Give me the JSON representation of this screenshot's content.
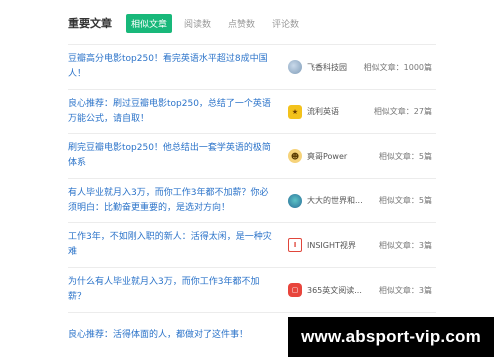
{
  "header": {
    "title": "重要文章",
    "tabs": [
      {
        "label": "相似文章",
        "active": true
      },
      {
        "label": "阅读数",
        "active": false
      },
      {
        "label": "点赞数",
        "active": false
      },
      {
        "label": "评论数",
        "active": false
      }
    ]
  },
  "articles": [
    {
      "title": "豆瓣高分电影top250！看完英语水平超过8成中国人！",
      "author": "飞香科技园",
      "author_icon": "planet-avatar-icon",
      "count": "相似文章：1000篇"
    },
    {
      "title": "良心推荐：刷过豆瓣电影top250，总结了一个英语万能公式，请自取！",
      "author": "流利英语",
      "author_icon": "book-avatar-icon",
      "count": "相似文章：27篇"
    },
    {
      "title": "刷完豆瓣电影top250！他总结出一套学英语的极简体系",
      "author": "爽哥Power",
      "author_icon": "face-avatar-icon",
      "count": "相似文章：5篇"
    },
    {
      "title": "有人毕业就月入3万，而你工作3年都不加薪？你必须明白：比勤奋更重要的，是选对方向！",
      "author": "大大的世界和...",
      "author_icon": "bird-avatar-icon",
      "count": "相似文章：5篇"
    },
    {
      "title": "工作3年，不如刚入职的新人：活得太闲，是一种灾难",
      "author": "INSIGHT视界",
      "author_icon": "insight-avatar-icon",
      "count": "相似文章：3篇"
    },
    {
      "title": "为什么有人毕业就月入3万，而你工作3年都不加薪？",
      "author": "365英文阅读...",
      "author_icon": "red-avatar-icon",
      "count": "相似文章：3篇"
    },
    {
      "title": "良心推荐：活得体面的人，都做对了这件事！",
      "author": "",
      "author_icon": "dark-avatar-icon",
      "count": ""
    }
  ],
  "watermark": "www.absport-vip.com",
  "colors": {
    "accent": "#18b87a",
    "link": "#2b73c9"
  }
}
